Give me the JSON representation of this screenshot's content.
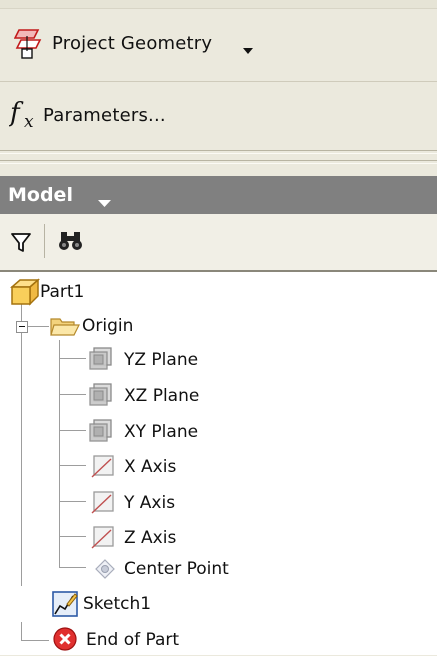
{
  "commands": {
    "project_geometry": {
      "label": "Project Geometry",
      "icon": "project-geometry-icon"
    },
    "parameters": {
      "label": "Parameters...",
      "icon": "fx-icon"
    }
  },
  "browser": {
    "title": "Model",
    "toolbar": {
      "filter_icon": "filter-icon",
      "find_icon": "binoculars-icon"
    },
    "tree": {
      "root": "Part1",
      "origin": "Origin",
      "origin_items": [
        "YZ Plane",
        "XZ Plane",
        "XY Plane",
        "X Axis",
        "Y Axis",
        "Z Axis",
        "Center Point"
      ],
      "sketch": "Sketch1",
      "end": "End of Part"
    }
  },
  "colors": {
    "header_bg": "#808080",
    "panel_bg": "#ebe9dd",
    "tree_bg": "#ffffff",
    "end_icon": "#e0302f",
    "part_icon": "#f3c44a"
  }
}
